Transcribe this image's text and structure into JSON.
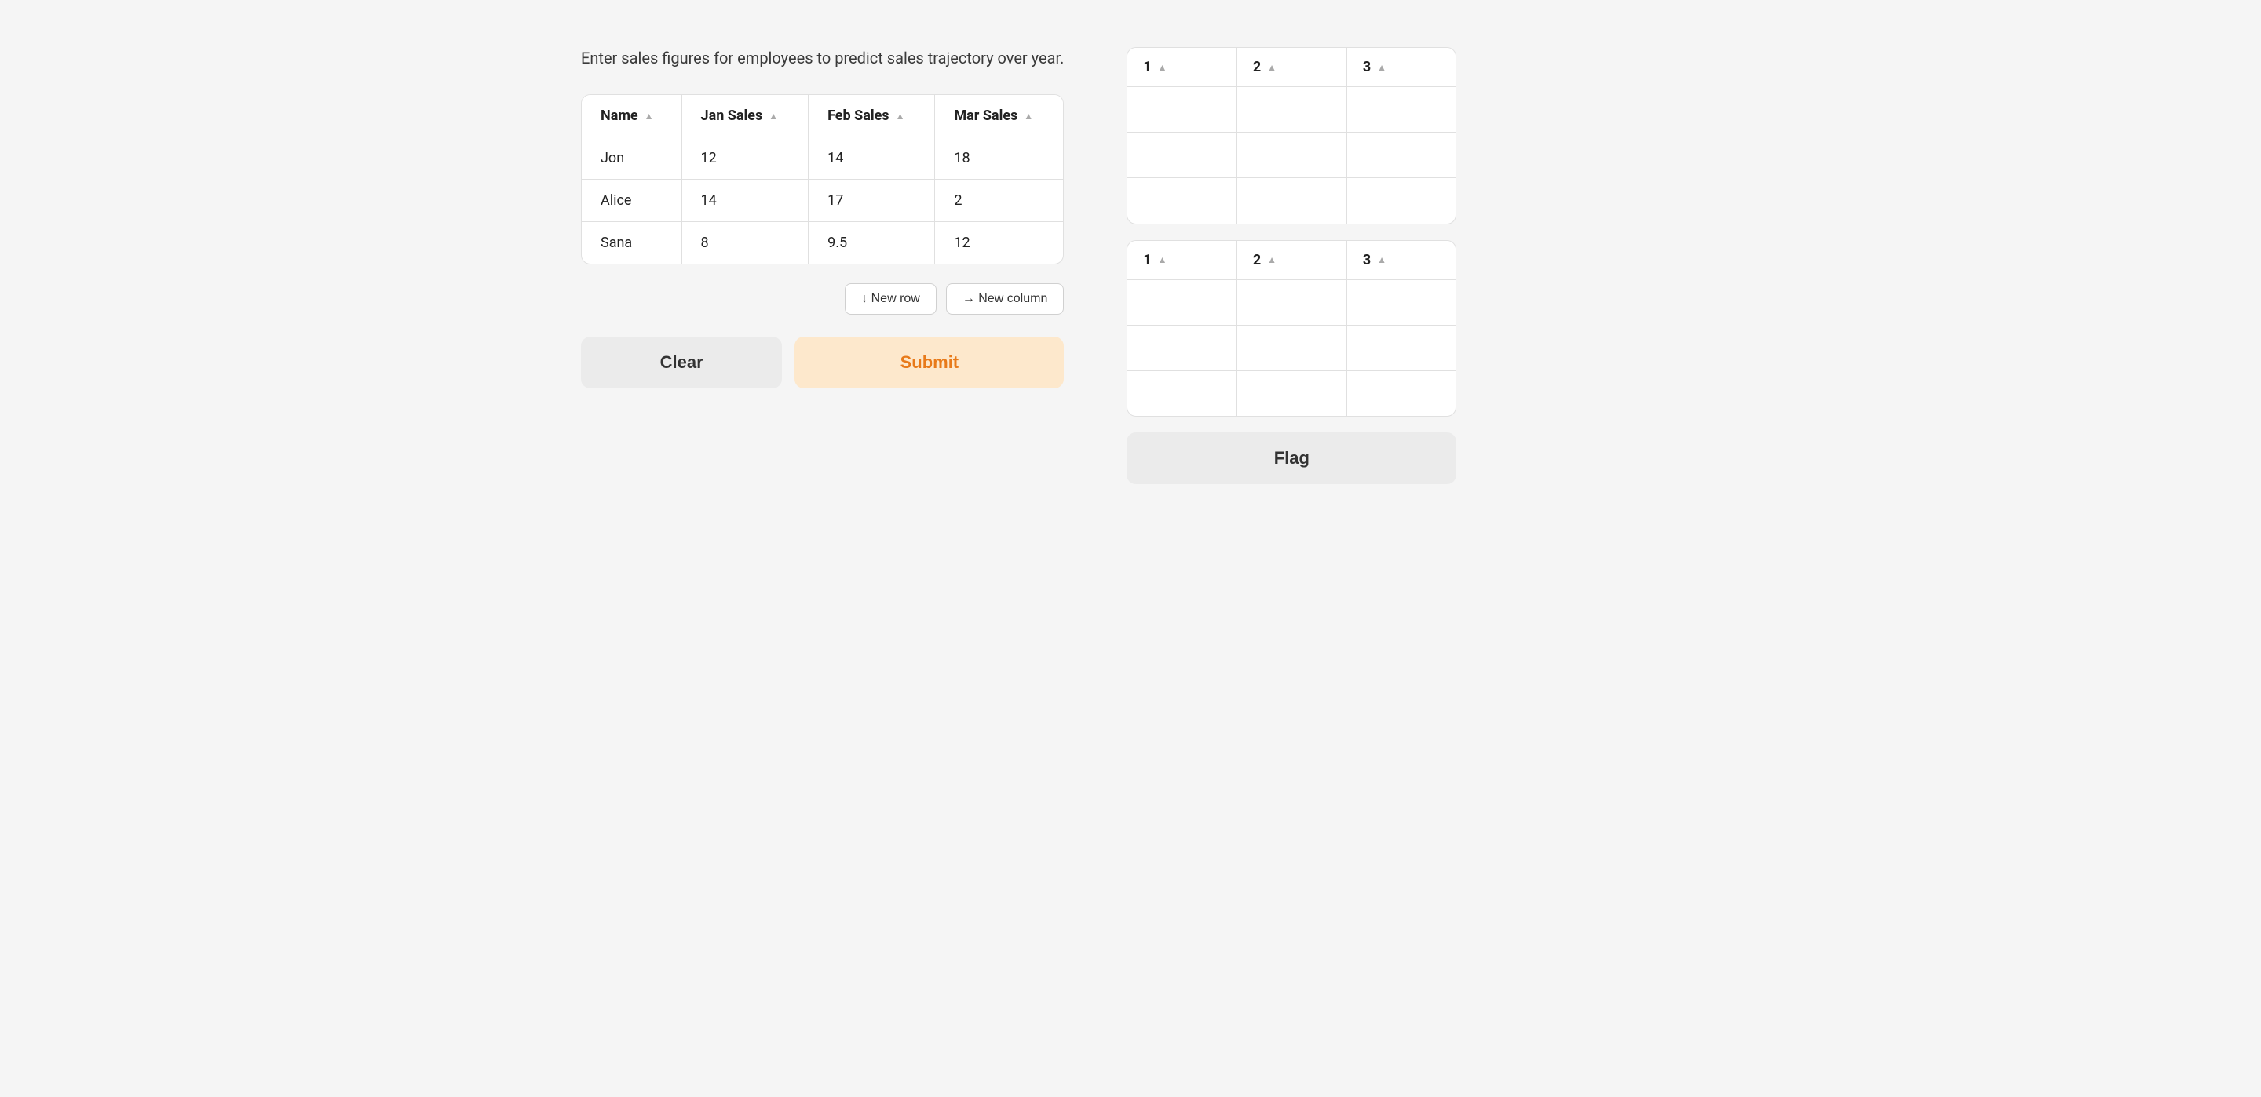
{
  "description": "Enter sales figures for employees to predict sales trajectory over year.",
  "main_table": {
    "columns": [
      {
        "label": "Name"
      },
      {
        "label": "Jan Sales"
      },
      {
        "label": "Feb Sales"
      },
      {
        "label": "Mar Sales"
      }
    ],
    "rows": [
      {
        "name": "Jon",
        "jan": "12",
        "feb": "14",
        "mar": "18"
      },
      {
        "name": "Alice",
        "jan": "14",
        "feb": "17",
        "mar": "2"
      },
      {
        "name": "Sana",
        "jan": "8",
        "feb": "9.5",
        "mar": "12"
      }
    ]
  },
  "action_buttons": {
    "new_row_label": "↓ New row",
    "new_column_label": "→ New column"
  },
  "bottom_buttons": {
    "clear_label": "Clear",
    "submit_label": "Submit"
  },
  "secondary_table_1": {
    "columns": [
      {
        "label": "1"
      },
      {
        "label": "2"
      },
      {
        "label": "3"
      }
    ],
    "rows": [
      {
        "c1": "",
        "c2": "",
        "c3": ""
      },
      {
        "c1": "",
        "c2": "",
        "c3": ""
      },
      {
        "c1": "",
        "c2": "",
        "c3": ""
      }
    ]
  },
  "secondary_table_2": {
    "columns": [
      {
        "label": "1"
      },
      {
        "label": "2"
      },
      {
        "label": "3"
      }
    ],
    "rows": [
      {
        "c1": "",
        "c2": "",
        "c3": ""
      },
      {
        "c1": "",
        "c2": "",
        "c3": ""
      },
      {
        "c1": "",
        "c2": "",
        "c3": ""
      }
    ]
  },
  "flag_button": {
    "label": "Flag"
  }
}
